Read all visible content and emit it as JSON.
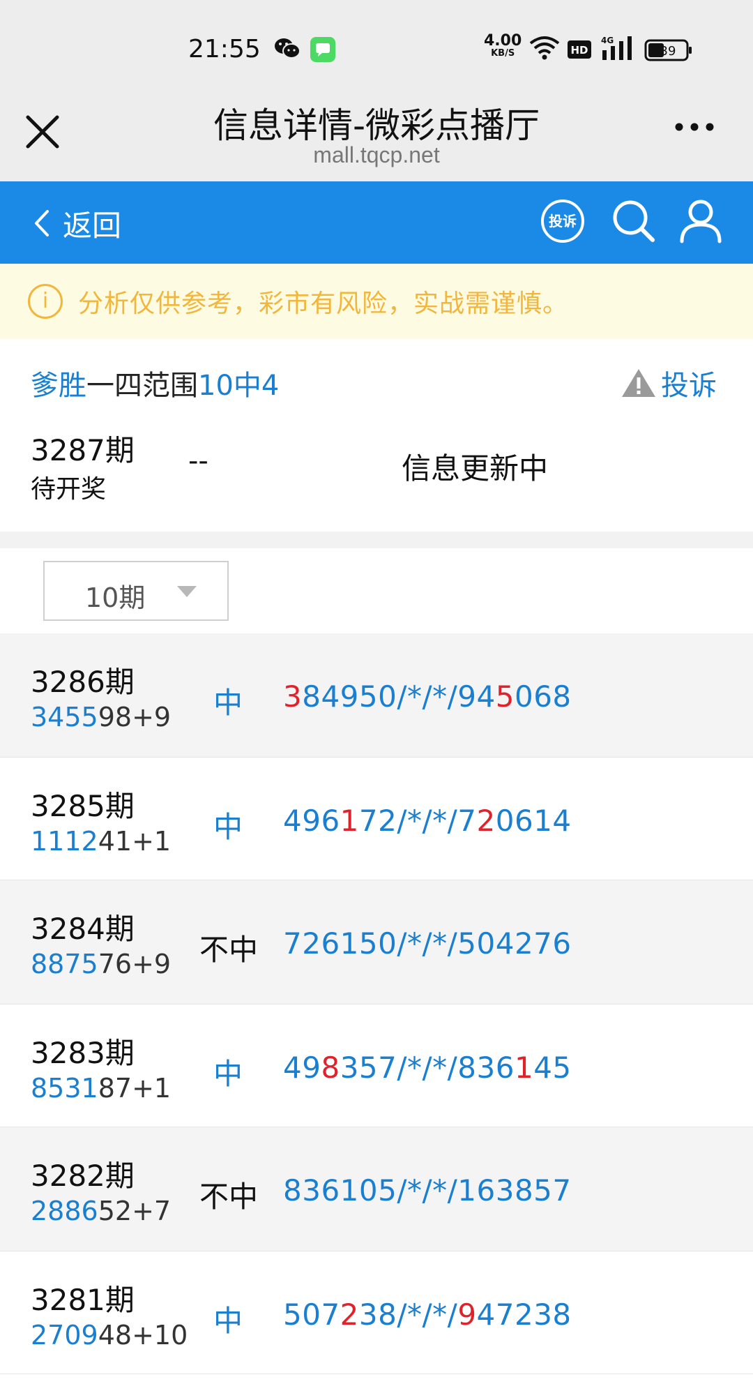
{
  "status_bar": {
    "time": "21:55",
    "net_speed": "4.00",
    "net_unit": "KB/S",
    "hd": "HD",
    "network": "4G",
    "battery": "39"
  },
  "titlebar": {
    "title": "信息详情-微彩点播厅",
    "url": "mall.tqcp.net"
  },
  "navbar": {
    "back_label": "返回",
    "complain_label": "投诉"
  },
  "notice": {
    "text": "分析仅供参考，彩市有风险，实战需谨慎。"
  },
  "info": {
    "author": "爹胜",
    "plan_name": "一四范围",
    "record": "10中4",
    "complain": "投诉",
    "current_period": "3287期",
    "current_state": "待开奖",
    "current_dash": "--",
    "current_message": "信息更新中"
  },
  "filter": {
    "selected": "10期"
  },
  "rows": [
    {
      "period": "3286期",
      "code_hl": "3455",
      "code_rest": "98+9",
      "result": "中",
      "hit": true,
      "nums": [
        [
          "3",
          "r"
        ],
        [
          "84950/*/*/94",
          "b"
        ],
        [
          "5",
          "r"
        ],
        [
          "068",
          "b"
        ]
      ]
    },
    {
      "period": "3285期",
      "code_hl": "1112",
      "code_rest": "41+1",
      "result": "中",
      "hit": true,
      "nums": [
        [
          "496",
          "b"
        ],
        [
          "1",
          "r"
        ],
        [
          "72/*/*/7",
          "b"
        ],
        [
          "2",
          "r"
        ],
        [
          "0614",
          "b"
        ]
      ]
    },
    {
      "period": "3284期",
      "code_hl": "8875",
      "code_rest": "76+9",
      "result": "不中",
      "hit": false,
      "nums": [
        [
          "726150/*/*/504276",
          "b"
        ]
      ]
    },
    {
      "period": "3283期",
      "code_hl": "8531",
      "code_rest": "87+1",
      "result": "中",
      "hit": true,
      "nums": [
        [
          "49",
          "b"
        ],
        [
          "8",
          "r"
        ],
        [
          "357/*/*/836",
          "b"
        ],
        [
          "1",
          "r"
        ],
        [
          "45",
          "b"
        ]
      ]
    },
    {
      "period": "3282期",
      "code_hl": "2886",
      "code_rest": "52+7",
      "result": "不中",
      "hit": false,
      "nums": [
        [
          "836105/*/*/163857",
          "b"
        ]
      ]
    },
    {
      "period": "3281期",
      "code_hl": "2709",
      "code_rest": "48+10",
      "result": "中",
      "hit": true,
      "nums": [
        [
          "507",
          "b"
        ],
        [
          "2",
          "r"
        ],
        [
          "38/*/*/",
          "b"
        ],
        [
          "9",
          "r"
        ],
        [
          "47238",
          "b"
        ]
      ]
    }
  ]
}
